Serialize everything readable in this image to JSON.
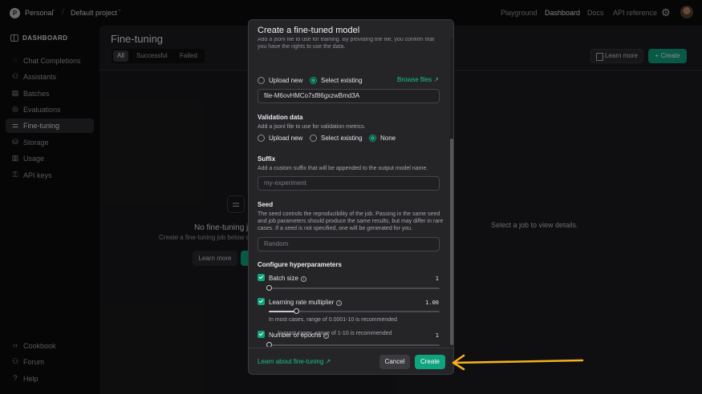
{
  "topbar": {
    "org_initial": "P",
    "org_name": "Personal",
    "project_name": "Default project",
    "nav": [
      "Playground",
      "Dashboard",
      "Docs",
      "API reference"
    ]
  },
  "sidebar": {
    "heading": "DASHBOARD",
    "items": [
      {
        "label": "Chat Completions",
        "icon": "chat-icon"
      },
      {
        "label": "Assistants",
        "icon": "assistants-icon"
      },
      {
        "label": "Batches",
        "icon": "batches-icon"
      },
      {
        "label": "Evaluations",
        "icon": "evaluations-icon"
      },
      {
        "label": "Fine-tuning",
        "icon": "fine-tuning-icon",
        "active": true
      },
      {
        "label": "Storage",
        "icon": "storage-icon"
      },
      {
        "label": "Usage",
        "icon": "usage-icon"
      },
      {
        "label": "API keys",
        "icon": "key-icon"
      }
    ],
    "bottom_items": [
      {
        "label": "Cookbook",
        "icon": "code-icon"
      },
      {
        "label": "Forum",
        "icon": "forum-icon"
      },
      {
        "label": "Help",
        "icon": "help-icon"
      }
    ]
  },
  "main": {
    "title": "Fine-tuning",
    "filters": [
      "All",
      "Successful",
      "Failed"
    ],
    "learn_more": "Learn more",
    "create": "+ Create",
    "empty_title": "No fine-tuning jo",
    "empty_sub": "Create a fine-tuning job below c",
    "empty_learn": "Learn more",
    "detail_msg": "Select a job to view details."
  },
  "modal": {
    "title": "Create a fine-tuned model",
    "cut_text": "Add a jsonl file to use for training. By providing the file, you confirm that you have the rights to use the data.",
    "training": {
      "options": [
        "Upload new",
        "Select existing"
      ],
      "selected": "Select existing",
      "browse": "Browse files ↗",
      "file_value": "file-M6ovHMCo7sf86gxzwBmd3A"
    },
    "validation": {
      "title": "Validation data",
      "desc": "Add a jsonl file to use for validation metrics.",
      "options": [
        "Upload new",
        "Select existing",
        "None"
      ],
      "selected": "None"
    },
    "suffix": {
      "title": "Suffix",
      "desc": "Add a custom suffix that will be appended to the output model name.",
      "placeholder": "my-experiment"
    },
    "seed": {
      "title": "Seed",
      "desc": "The seed controls the reproducibility of the job. Passing in the same seed and job parameters should produce the same results, but may differ in rare cases. If a seed is not specified, one will be generated for you.",
      "placeholder": "Random"
    },
    "hyper": {
      "title": "Configure hyperparameters",
      "params": [
        {
          "label": "Batch size",
          "value": "1",
          "slider_fraction": 0.0,
          "hint": ""
        },
        {
          "label": "Learning rate multiplier",
          "value": "1.00",
          "slider_fraction": 0.16,
          "hint": "In most cases, range of 0.0001-10 is recommended"
        },
        {
          "label": "Number of epochs",
          "value": "1",
          "slider_fraction": 0.0,
          "hint": "In most cases, range of 1-10 is recommended"
        }
      ]
    },
    "footer": {
      "link": "Learn about fine-tuning ↗",
      "cancel": "Cancel",
      "create": "Create"
    }
  },
  "colors": {
    "accent": "#10a37f",
    "annotation_arrow": "#f5b120"
  }
}
